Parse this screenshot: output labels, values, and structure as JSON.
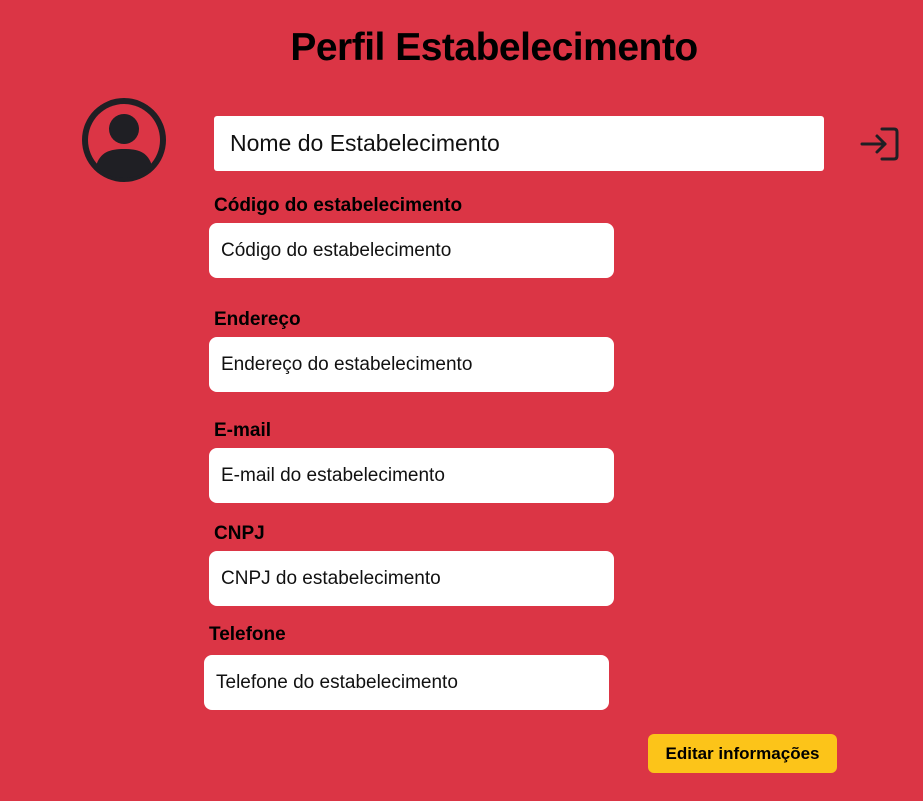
{
  "page": {
    "title": "Perfil Estabelecimento"
  },
  "profile": {
    "avatar_icon": "user-circle-icon",
    "name_placeholder": "Nome do Estabelecimento",
    "logout_icon": "login-enter-icon"
  },
  "fields": {
    "codigo": {
      "label": "Código do estabelecimento",
      "placeholder": "Código do estabelecimento"
    },
    "endereco": {
      "label": "Endereço",
      "placeholder": "Endereço do estabelecimento"
    },
    "email": {
      "label": "E-mail",
      "placeholder": "E-mail do estabelecimento"
    },
    "cnpj": {
      "label": "CNPJ",
      "placeholder": "CNPJ do estabelecimento"
    },
    "telefone": {
      "label": "Telefone",
      "placeholder": "Telefone do estabelecimento"
    }
  },
  "actions": {
    "edit_label": "Editar informações"
  },
  "colors": {
    "background": "#db3545",
    "button": "#fcc419",
    "input": "#ffffff",
    "icon": "#1f1f24"
  }
}
